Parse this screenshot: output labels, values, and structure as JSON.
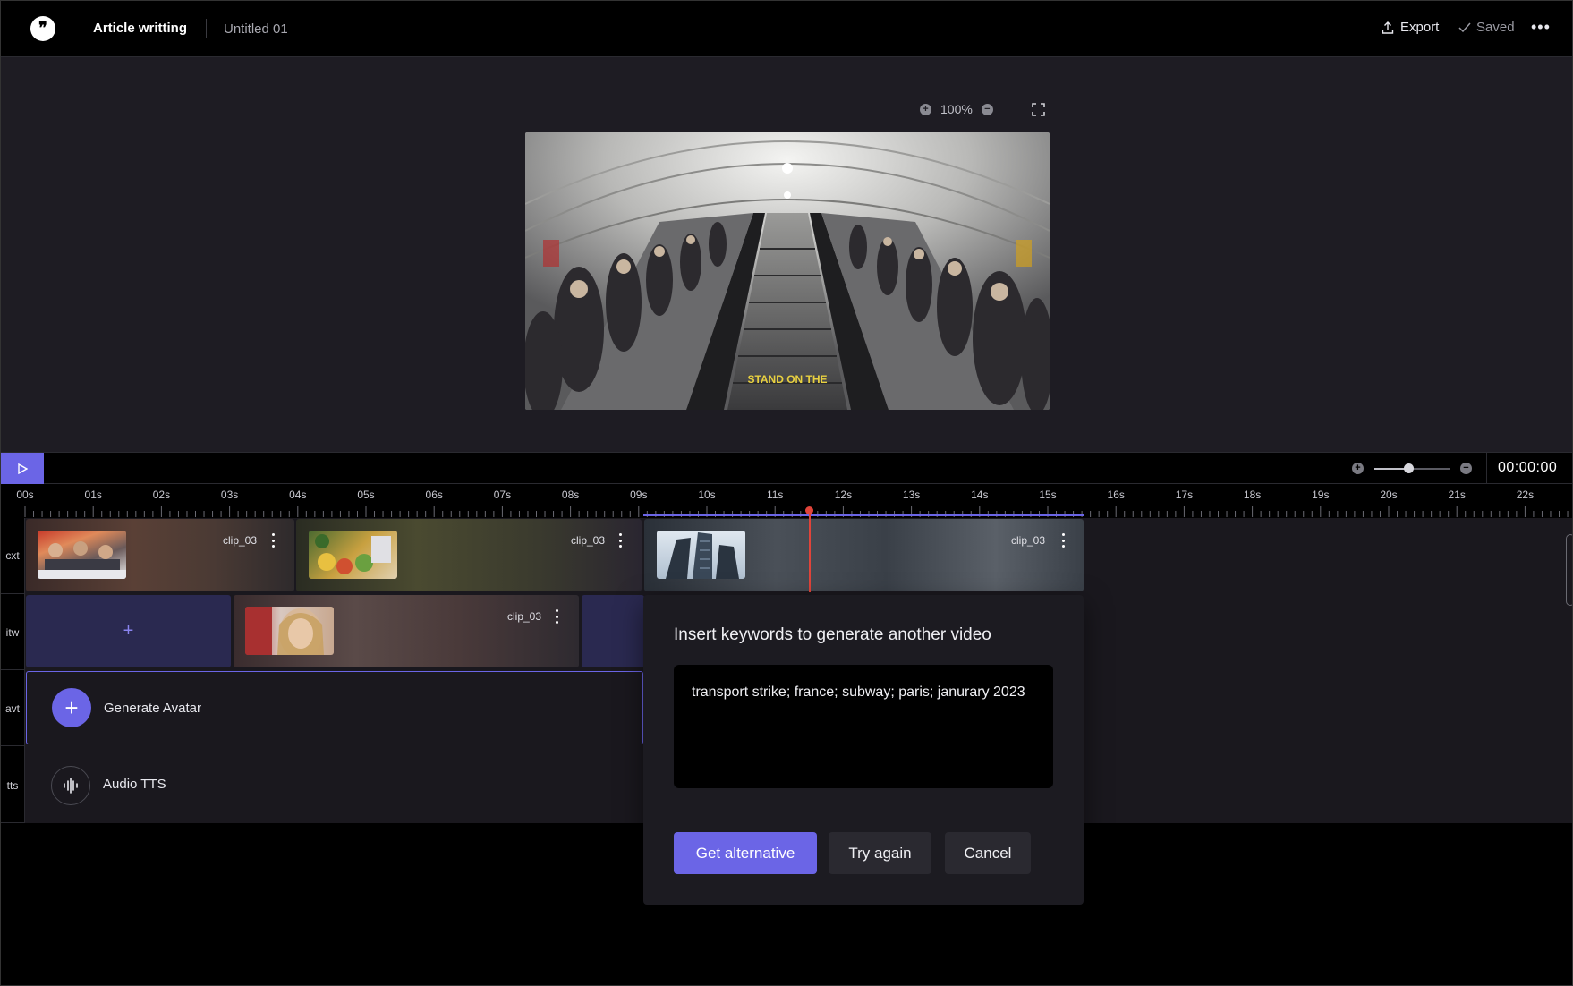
{
  "header": {
    "project_title": "Article writting",
    "document_title": "Untitled 01",
    "export_label": "Export",
    "saved_label": "Saved",
    "more_label": "•••"
  },
  "preview": {
    "zoom_level": "100%",
    "video_caption": "STAND ON THE"
  },
  "playbar": {
    "timecode": "00:00:00",
    "zoom_slider_fraction": 0.45
  },
  "ruler": {
    "ticks": [
      "00s",
      "01s",
      "02s",
      "03s",
      "04s",
      "05s",
      "06s",
      "07s",
      "08s",
      "09s",
      "10s",
      "11s",
      "12s",
      "13s",
      "14s",
      "15s",
      "16s",
      "17s",
      "18s",
      "19s",
      "20s",
      "21s",
      "22s"
    ]
  },
  "tracks": {
    "labels": [
      "cxt",
      "itw",
      "avt",
      "tts"
    ],
    "cxt_clips": [
      {
        "name": "clip_03"
      },
      {
        "name": "clip_03"
      },
      {
        "name": "clip_03"
      }
    ],
    "itw_clips": [
      {
        "name": "clip_03"
      }
    ],
    "add_label": "+",
    "avatar_plus": "+",
    "avatar_label": "Generate Avatar",
    "tts_label": "Audio TTS"
  },
  "dialog": {
    "title": "Insert keywords to generate another video",
    "keywords": "transport strike; france; subway; paris; janurary 2023",
    "primary_button": "Get alternative",
    "secondary_button": "Try again",
    "cancel_button": "Cancel"
  },
  "colors": {
    "accent": "#6b65e6",
    "playhead": "#e0443a",
    "panel": "#1e1c23",
    "background": "#000000"
  }
}
